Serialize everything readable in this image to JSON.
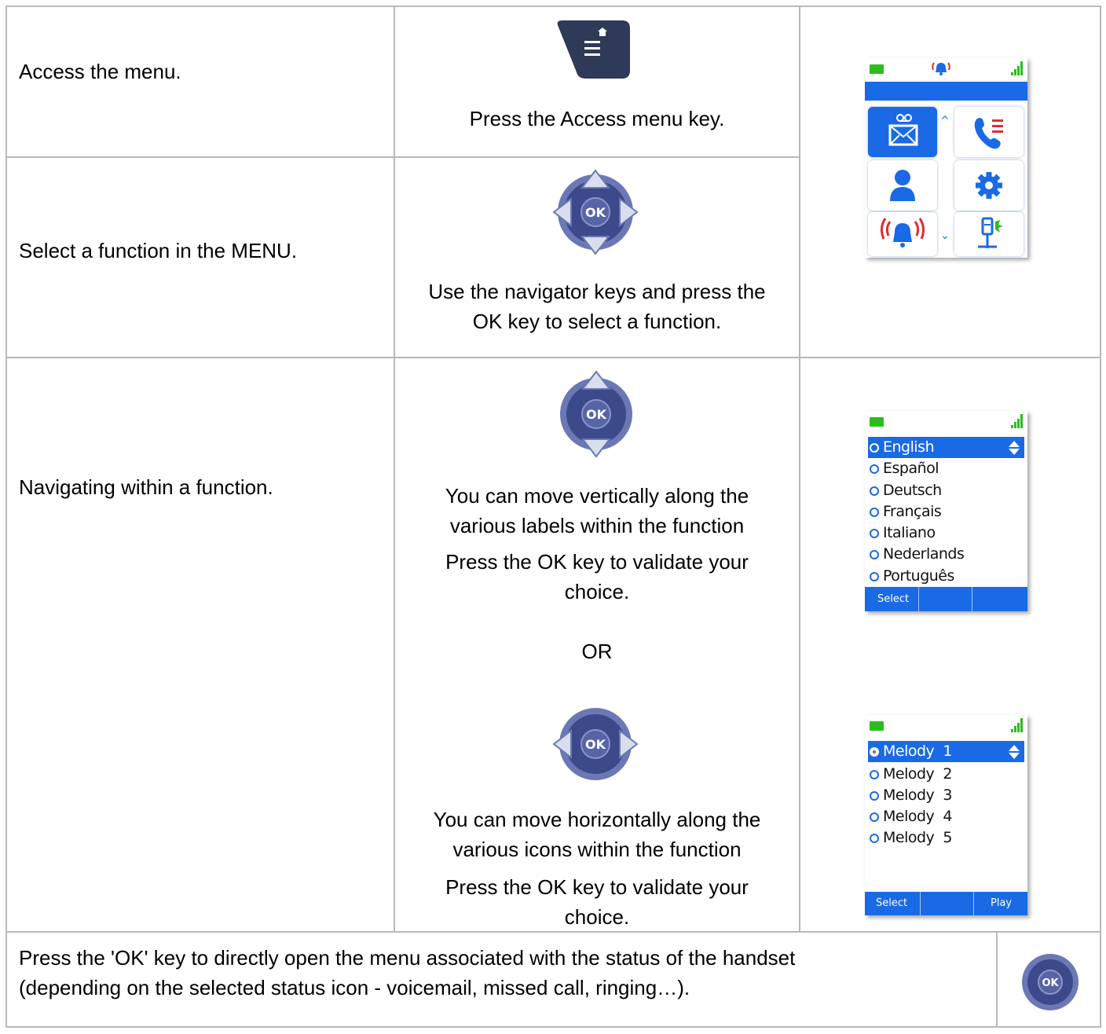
{
  "rows": [
    {
      "label": "Access the menu.",
      "instruction": "Press the Access menu key."
    },
    {
      "label": "Select a function in the MENU.",
      "instruction_lines": [
        "Use the navigator keys and press the",
        "OK key to select a function."
      ]
    },
    {
      "label": "Navigating within a function.",
      "vertical_lines": [
        "You can move vertically along the",
        "various labels within the function"
      ],
      "validate_lines_1": [
        "Press the OK key to validate your",
        "choice."
      ],
      "or": "OR",
      "horizontal_lines": [
        "You can move horizontally along the",
        "various icons within the function"
      ],
      "validate_lines_2": [
        "Press the OK key to validate your",
        "choice."
      ]
    }
  ],
  "footer": {
    "lines": [
      "Press the 'OK' key to directly open the menu associated with the status of the handset",
      "(depending on the selected status icon - voicemail, missed call, ringing…)."
    ]
  },
  "ok_key_label": "OK",
  "language_screen": {
    "items": [
      "English",
      "Español",
      "Deutsch",
      "Français",
      "Italiano",
      "Nederlands",
      "Português"
    ],
    "selected_index": 0,
    "softkeys": [
      "Select",
      "",
      ""
    ]
  },
  "melody_screen": {
    "items": [
      "Melody  1",
      "Melody  2",
      "Melody  3",
      "Melody  4",
      "Melody  5"
    ],
    "selected_index": 0,
    "softkeys": [
      "Select",
      "",
      "Play"
    ]
  },
  "menu_screen": {
    "icons": [
      "voicemail-icon",
      "call-log-icon",
      "contacts-icon",
      "settings-icon",
      "alarm-icon",
      "handset-settings-icon"
    ]
  },
  "colors": {
    "screen_blue": "#1a6ae6",
    "battery_green": "#2bbd1d",
    "nav_key": "#3c4a8c",
    "menu_key": "#2f3a58",
    "alarm_red": "#e22c2c"
  }
}
